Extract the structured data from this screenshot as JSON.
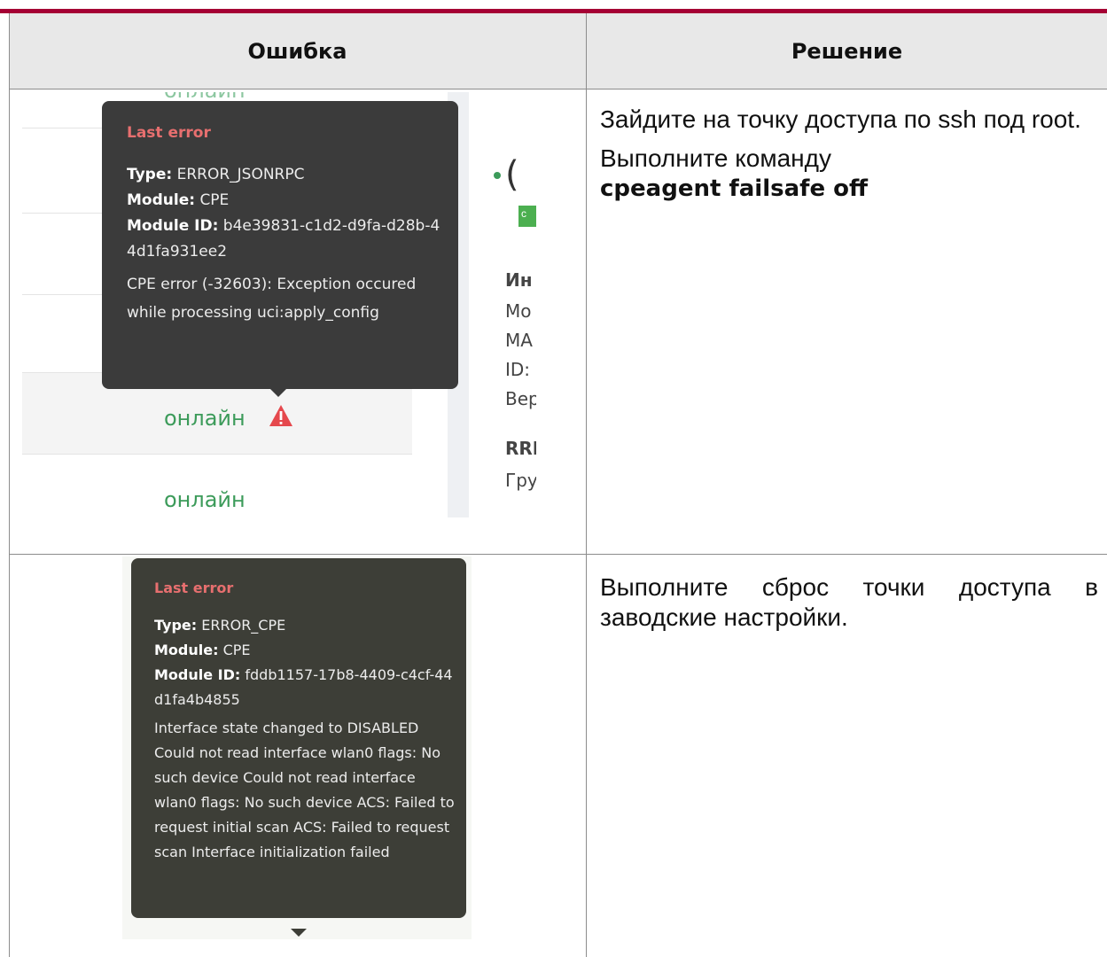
{
  "header": {
    "col_error": "Ошибка",
    "col_solution": "Решение"
  },
  "row1": {
    "screenshot": {
      "top_status": "онлайн",
      "tooltip": {
        "title": "Last error",
        "type_label": "Type:",
        "type_value": "ERROR_JSONRPC",
        "module_label": "Module:",
        "module_value": "CPE",
        "module_id_label": "Module ID:",
        "module_id_value": "b4e39831-c1d2-d9fa-d28b-44d1fa931ee2",
        "message": "CPE error (-32603): Exception occured while processing uci:apply_config"
      },
      "status_1": "онлайн",
      "status_2": "онлайн",
      "right_panel": [
        "Ин",
        "Мо",
        "МА",
        "ID:",
        "Вер",
        "RRI",
        "Гру"
      ],
      "right_big_char": "(",
      "right_small_char": "c"
    },
    "solution": {
      "line1": "Зайдите на точку доступа по ssh под root.",
      "line2": "Выполните команду",
      "command": "cpeagent failsafe off"
    }
  },
  "row2": {
    "screenshot": {
      "tooltip": {
        "title": "Last error",
        "type_label": "Type:",
        "type_value": "ERROR_CPE",
        "module_label": "Module:",
        "module_value": "CPE",
        "module_id_label": "Module ID:",
        "module_id_value": "fddb1157-17b8-4409-c4cf-44d1fa4b4855",
        "message": "Interface state changed to DISABLED Could not read interface wlan0 flags: No such device Could not read interface wlan0 flags: No such device ACS: Failed to request initial scan ACS: Failed to request scan Interface initialization failed"
      }
    },
    "solution": {
      "line1": "Выполните сброс точки доступа в заводские настройки."
    }
  },
  "colors": {
    "accent_bar": "#a50034",
    "header_bg": "#e8e8e8",
    "status_green": "#3c9b5a",
    "error_red": "#e76f6f",
    "warning_red": "#e5484d"
  }
}
